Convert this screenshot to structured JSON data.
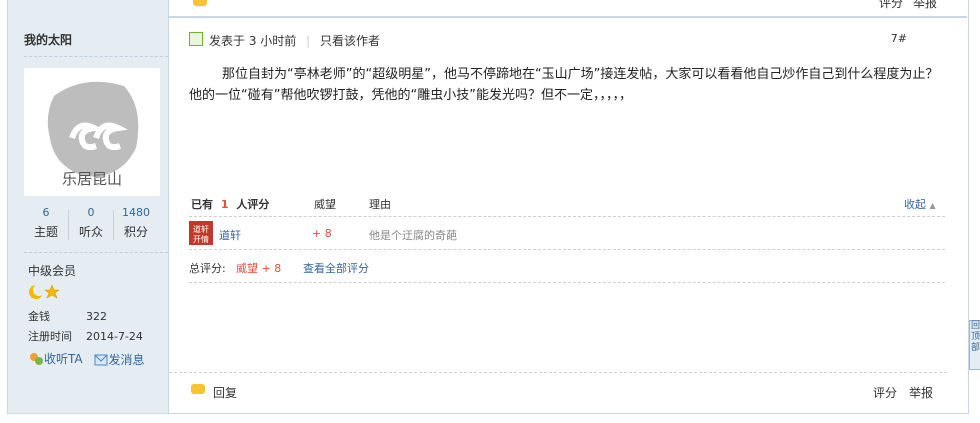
{
  "topstrip": {
    "reply_label": "回复",
    "rate_label": "评分",
    "report_label": "举报"
  },
  "sidebar": {
    "username": "我的太阳",
    "avatar_text": "乐居昆山",
    "stats": [
      {
        "value": "6",
        "label": "主题"
      },
      {
        "value": "0",
        "label": "听众"
      },
      {
        "value": "1480",
        "label": "积分"
      }
    ],
    "rank": "中级会员",
    "fields": [
      {
        "key": "金钱",
        "value": "322"
      },
      {
        "key": "注册时间",
        "value": "2014-7-24"
      }
    ],
    "follow_label": "收听TA",
    "message_label": "发消息"
  },
  "post": {
    "posted_prefix": "发表于",
    "posted_time": "3 小时前",
    "author_only": "只看该作者",
    "floor": "7#",
    "content": "那位自封为“亭林老师”的“超级明星”，他马不停蹄地在“玉山广场”接连发帖，大家可以看看他自己炒作自己到什么程度为止？ 他的一位“碰有”帮他吹锣打鼓，凭他的“雕虫小技”能发光吗？但不一定，，，，，"
  },
  "rating": {
    "header_prefix": "已有",
    "count": "1",
    "header_suffix": "人评分",
    "col_prestige": "威望",
    "col_reason": "理由",
    "collapse_label": "收起",
    "rows": [
      {
        "user": "道轩",
        "prestige": "+ 8",
        "reason": "他是个迂腐的奇葩",
        "avatar_text": "道轩"
      }
    ],
    "total_label": "总评分:",
    "total_value": "威望 + 8",
    "view_all": "查看全部评分"
  },
  "bottombar": {
    "reply_label": "回复",
    "rate_label": "评分",
    "report_label": "举报"
  },
  "sidetab": {
    "label": "回顶部"
  },
  "colors": {
    "link": "#336699",
    "accent_red": "#e74c3c",
    "sidebar_bg": "#e5edf2"
  }
}
